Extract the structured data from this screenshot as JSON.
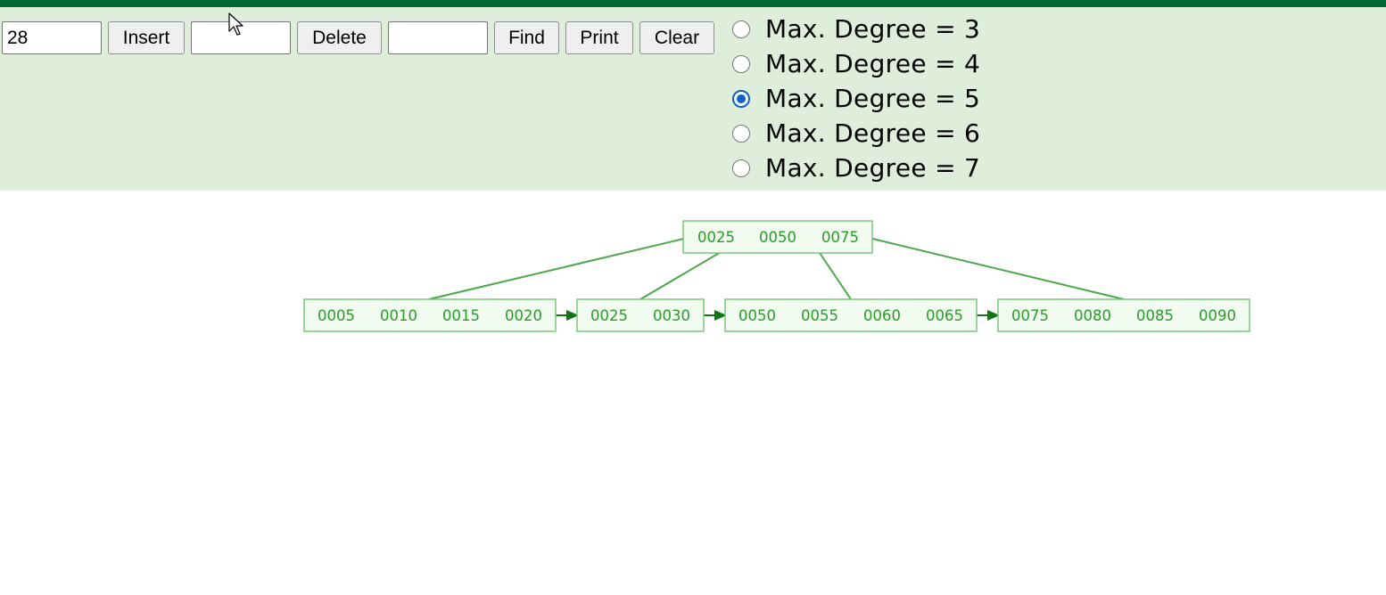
{
  "controls": {
    "insert_value": "28",
    "insert_label": "Insert",
    "delete_value": "",
    "delete_label": "Delete",
    "find_value": "",
    "find_label": "Find",
    "print_label": "Print",
    "clear_label": "Clear"
  },
  "degree_options": [
    {
      "label": "Max. Degree = 3",
      "checked": false
    },
    {
      "label": "Max. Degree = 4",
      "checked": false
    },
    {
      "label": "Max. Degree = 5",
      "checked": true
    },
    {
      "label": "Max. Degree = 6",
      "checked": false
    },
    {
      "label": "Max. Degree = 7",
      "checked": false
    }
  ],
  "tree": {
    "root": {
      "keys": [
        "0025",
        "0050",
        "0075"
      ]
    },
    "leaves": [
      {
        "keys": [
          "0005",
          "0010",
          "0015",
          "0020"
        ]
      },
      {
        "keys": [
          "0025",
          "0030"
        ]
      },
      {
        "keys": [
          "0050",
          "0055",
          "0060",
          "0065"
        ]
      },
      {
        "keys": [
          "0075",
          "0080",
          "0085",
          "0090"
        ]
      }
    ]
  },
  "colors": {
    "header_bar": "#006633",
    "control_panel": "#deeedb",
    "node_border": "#7cc77c",
    "node_fill": "#f1fbf0",
    "key_text": "#2b9a2b",
    "edge": "#4aa84a",
    "leaf_arrow": "#117711",
    "radio_checked": "#0b63c4"
  },
  "icons": {
    "cursor": "mouse-pointer-icon"
  }
}
